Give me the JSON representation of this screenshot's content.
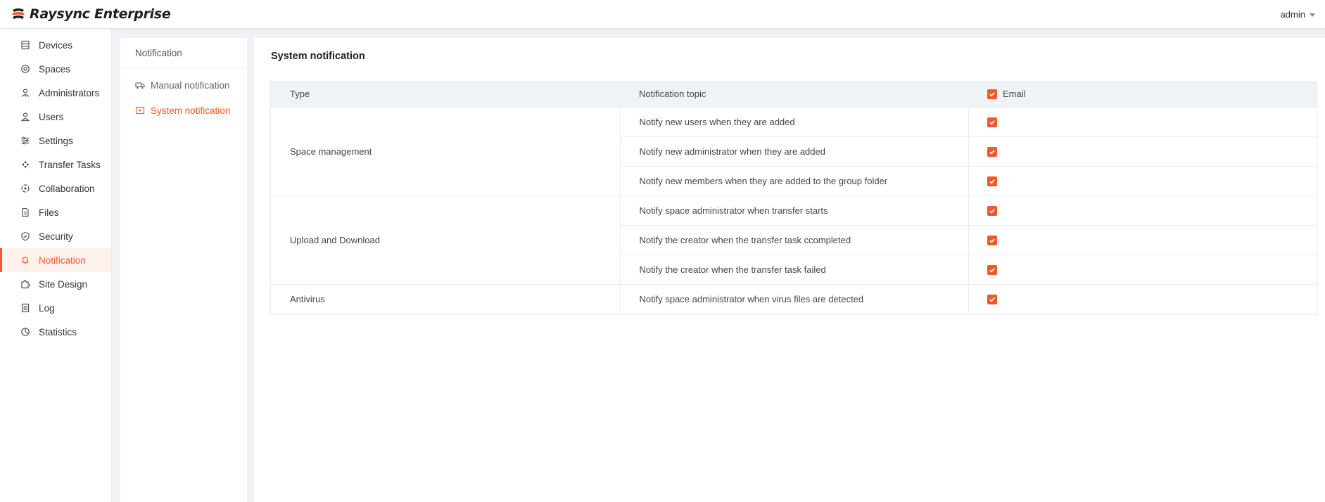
{
  "header": {
    "brand_name": "Raysync Enterprise",
    "user": "admin",
    "accent_color": "#f05a28"
  },
  "nav": {
    "items": [
      {
        "label": "Devices",
        "icon": "devices-icon"
      },
      {
        "label": "Spaces",
        "icon": "spaces-icon"
      },
      {
        "label": "Administrators",
        "icon": "administrators-icon"
      },
      {
        "label": "Users",
        "icon": "user-icon"
      },
      {
        "label": "Settings",
        "icon": "settings-sliders-icon"
      },
      {
        "label": "Transfer Tasks",
        "icon": "transfer-icon"
      },
      {
        "label": "Collaboration",
        "icon": "collaboration-icon"
      },
      {
        "label": "Files",
        "icon": "file-icon"
      },
      {
        "label": "Security",
        "icon": "shield-icon"
      },
      {
        "label": "Notification",
        "icon": "bell-icon",
        "active": true
      },
      {
        "label": "Site Design",
        "icon": "puzzle-icon"
      },
      {
        "label": "Log",
        "icon": "log-icon"
      },
      {
        "label": "Statistics",
        "icon": "pie-chart-icon"
      }
    ]
  },
  "subnav": {
    "title": "Notification",
    "items": [
      {
        "label": "Manual notification",
        "icon": "truck-icon"
      },
      {
        "label": "System notification",
        "icon": "play-box-icon",
        "active": true
      }
    ]
  },
  "main": {
    "title": "System notification",
    "columns": {
      "type": "Type",
      "topic": "Notification topic",
      "email": "Email"
    },
    "groups": [
      {
        "type": "Space management",
        "rows": [
          {
            "topic": "Notify new users when they are added",
            "email": true
          },
          {
            "topic": "Notify new administrator when they are added",
            "email": true
          },
          {
            "topic": "Notify new members when they are added to the group folder",
            "email": true
          }
        ]
      },
      {
        "type": "Upload and Download",
        "rows": [
          {
            "topic": "Notify space administrator when transfer starts",
            "email": true
          },
          {
            "topic": "Notify the creator when the transfer task ccompleted",
            "email": true
          },
          {
            "topic": "Notify the creator when the transfer task failed",
            "email": true
          }
        ]
      },
      {
        "type": "Antivirus",
        "rows": [
          {
            "topic": "Notify space administrator when virus files are detected",
            "email": true
          }
        ]
      }
    ]
  }
}
